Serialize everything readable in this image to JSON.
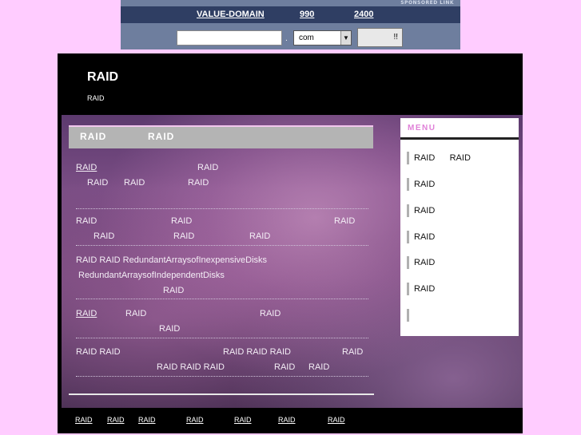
{
  "ad": {
    "sponsored": "SPONSORED LINK",
    "domain_link": "VALUE-DOMAIN",
    "price1": "990",
    "price2": "2400",
    "dot": ".",
    "tld_selected": "com",
    "button_label": "!!"
  },
  "header": {
    "title": "RAID",
    "subtitle": "RAID"
  },
  "content": {
    "head_a": "RAID",
    "head_b": "RAID",
    "p1": {
      "l1a": "RAID",
      "l1b": "RAID",
      "l2a": "RAID",
      "l2b": "RAID",
      "l2c": "RAID"
    },
    "p2": {
      "l1a": "RAID",
      "l1b": "RAID",
      "l1c": "RAID",
      "l2a": "RAID",
      "l2b": "RAID",
      "l2c": "RAID"
    },
    "p3": {
      "l1": "RAID  RAID  RedundantArraysofInexpensiveDisks",
      "l2": "RedundantArraysofIndependentDisks",
      "l3": "RAID"
    },
    "p4": {
      "l1a": "RAID",
      "l1b": "RAID",
      "l1c": "RAID",
      "l2": "RAID"
    },
    "p5": {
      "l1a": "RAID  RAID",
      "l1b": "RAID RAID  RAID",
      "l1c": "RAID",
      "l2a": "RAID  RAID  RAID",
      "l2b": "RAID",
      "l2c": "RAID"
    }
  },
  "menu": {
    "title": "MENU",
    "items": [
      "RAID      RAID",
      "RAID",
      "RAID",
      "RAID",
      "RAID",
      "RAID",
      ""
    ]
  },
  "footer": {
    "links": [
      "RAID",
      "RAID",
      "RAID",
      "RAID",
      "RAID",
      "RAID",
      "RAID",
      ""
    ]
  }
}
